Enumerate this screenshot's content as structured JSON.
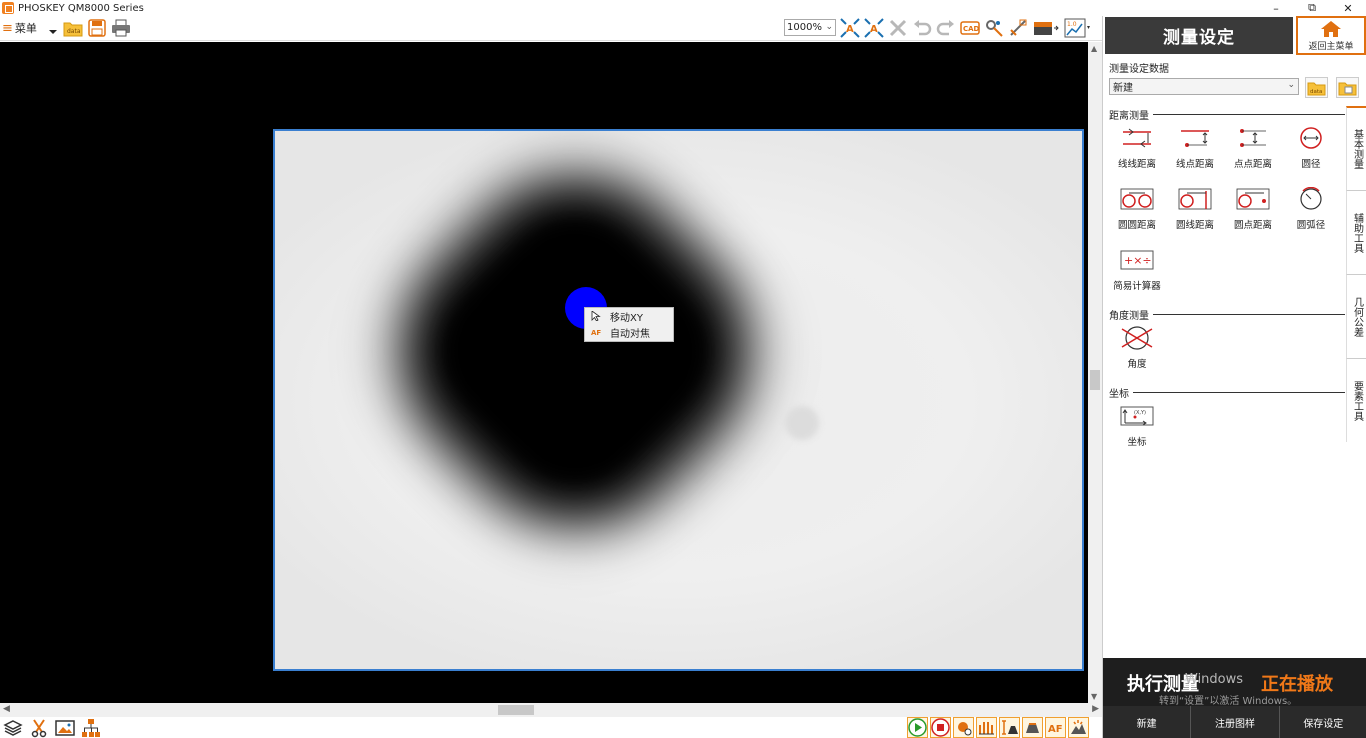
{
  "window": {
    "title": "PHOSKEY QM8000 Series",
    "minimize_glyph": "–",
    "restore_glyph": "⧉",
    "close_glyph": "✕"
  },
  "toolbar": {
    "menu_label": "菜单",
    "zoom_value": "1000%",
    "zoom_caret": "⌄"
  },
  "context_menu": {
    "items": [
      {
        "label": "移动XY",
        "icon": "pointer-icon"
      },
      {
        "label": "自动对焦",
        "icon": "autofocus-icon"
      }
    ]
  },
  "panel": {
    "header": "测量设定",
    "home_label": "返回主菜单",
    "data_section_label": "测量设定数据",
    "data_select_value": "新建",
    "distance_group": "距离测量",
    "distance_tools": [
      {
        "label": "线线距离",
        "icon": "line-line-distance-icon"
      },
      {
        "label": "线点距离",
        "icon": "line-point-distance-icon"
      },
      {
        "label": "点点距离",
        "icon": "point-point-distance-icon"
      },
      {
        "label": "圆径",
        "icon": "circle-diameter-icon"
      },
      {
        "label": "圆圆距离",
        "icon": "circle-circle-distance-icon"
      },
      {
        "label": "圆线距离",
        "icon": "circle-line-distance-icon"
      },
      {
        "label": "圆点距离",
        "icon": "circle-point-distance-icon"
      },
      {
        "label": "圆弧径",
        "icon": "arc-radius-icon"
      },
      {
        "label": "简易计算器",
        "icon": "calculator-icon"
      }
    ],
    "angle_group": "角度测量",
    "angle_tool": {
      "label": "角度",
      "icon": "angle-icon"
    },
    "coord_group": "坐标",
    "coord_tool": {
      "label": "坐标",
      "icon": "coordinate-icon"
    },
    "tabs": [
      "基本测量",
      "辅助工具",
      "几何公差",
      "要素工具"
    ],
    "execute_label": "执行测量",
    "playing_label": "正在播放",
    "watermark_line1": "Windows",
    "watermark_line2": "转到“设置”以激活 Windows。",
    "bottom_buttons": [
      "新建",
      "注册图样",
      "保存设定"
    ]
  },
  "colors": {
    "accent": "#e07010",
    "frame_border": "#3a7fd0",
    "panel_dark": "#3a3a3a",
    "exec_bar": "#1e1e1e",
    "cursor_dot": "#0000ff"
  }
}
